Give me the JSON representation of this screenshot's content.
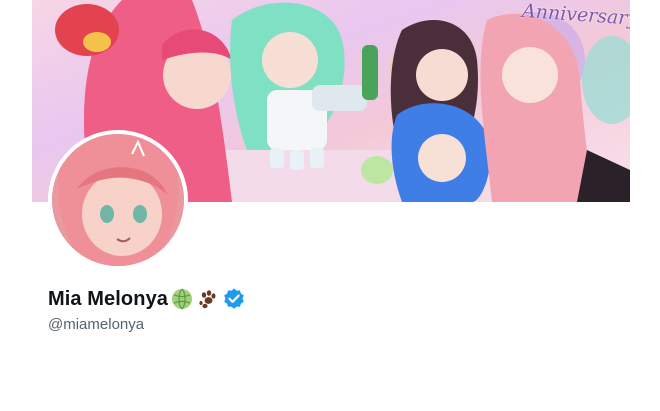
{
  "banner": {
    "text": "Anniversary",
    "palette": [
      "#f7d6e6",
      "#e9c7f0",
      "#ef5e87",
      "#7fe0c4",
      "#3f7ee6",
      "#f3a4b3"
    ]
  },
  "profile": {
    "display_name": "Mia Melonya",
    "handle": "@miamelonya",
    "emojis": [
      "melon",
      "paw-prints"
    ],
    "verified": true
  },
  "colors": {
    "name": "#0f1419",
    "handle": "#536471",
    "verified": "#1d9bf0"
  }
}
